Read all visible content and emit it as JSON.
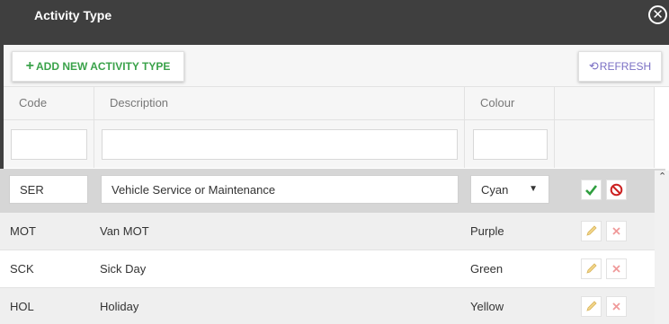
{
  "window": {
    "title": "Activity Type"
  },
  "toolbar": {
    "add_label": "ADD NEW ACTIVITY TYPE",
    "refresh_label": "REFRESH"
  },
  "columns": {
    "code": "Code",
    "description": "Description",
    "colour": "Colour"
  },
  "editing_row": {
    "code": "SER",
    "description": "Vehicle Service or Maintenance",
    "colour": "Cyan"
  },
  "rows": [
    {
      "code": "MOT",
      "description": "Van MOT",
      "colour": "Purple"
    },
    {
      "code": "SCK",
      "description": "Sick Day",
      "colour": "Green"
    },
    {
      "code": "HOL",
      "description": "Holiday",
      "colour": "Yellow"
    }
  ],
  "colors": {
    "titlebar": "#3f3f3f",
    "add_accent": "#3aa24a",
    "refresh_accent": "#7a6fc4",
    "confirm": "#2e9e3e",
    "cancel": "#cc2222"
  }
}
